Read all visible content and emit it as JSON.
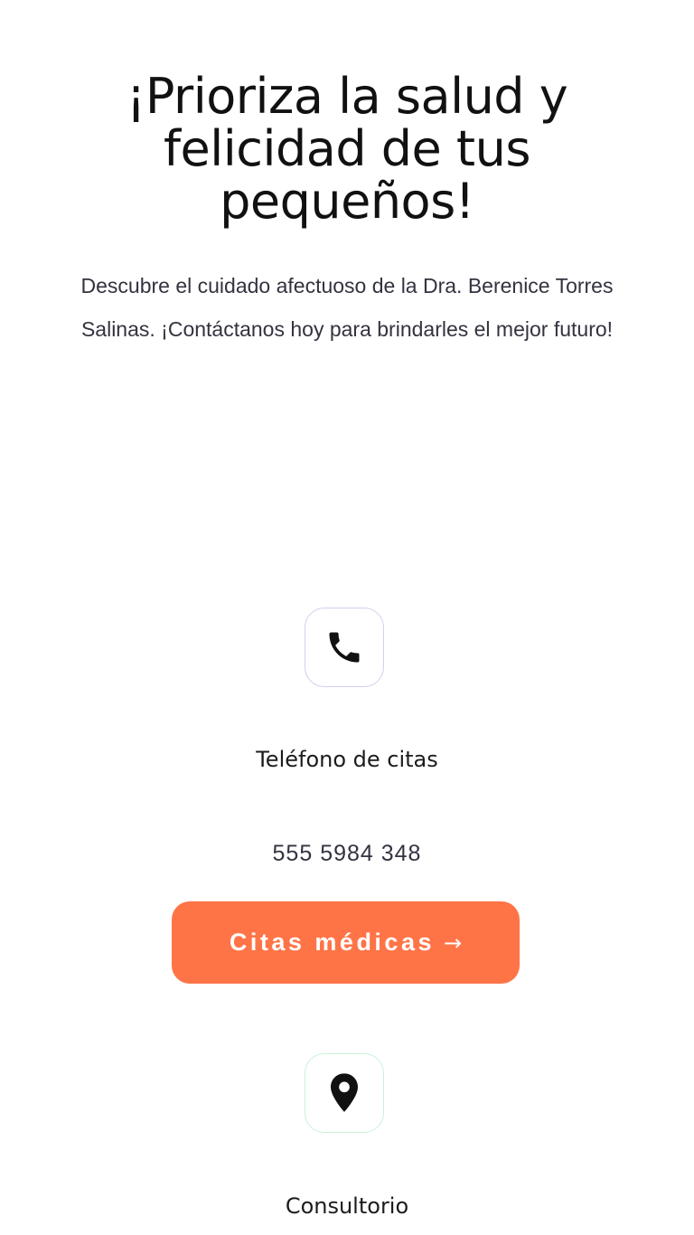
{
  "hero": {
    "title": "¡Prioriza la salud y felicidad de tus pequeños!",
    "subtitle": "Descubre el cuidado afectuoso de la Dra. Berenice Torres Salinas. ¡Contáctanos hoy para brindarles el mejor futuro!"
  },
  "contact": {
    "phone": {
      "icon": "phone-icon",
      "label": "Teléfono de citas",
      "number": "555 5984 348",
      "border_color": "#d6cdee"
    },
    "cta": {
      "label": "Citas médicas",
      "arrow": "→",
      "color": "#ff7447"
    },
    "office": {
      "icon": "location-pin-icon",
      "label": "Consultorio",
      "border_color": "#c8f2d6"
    }
  }
}
